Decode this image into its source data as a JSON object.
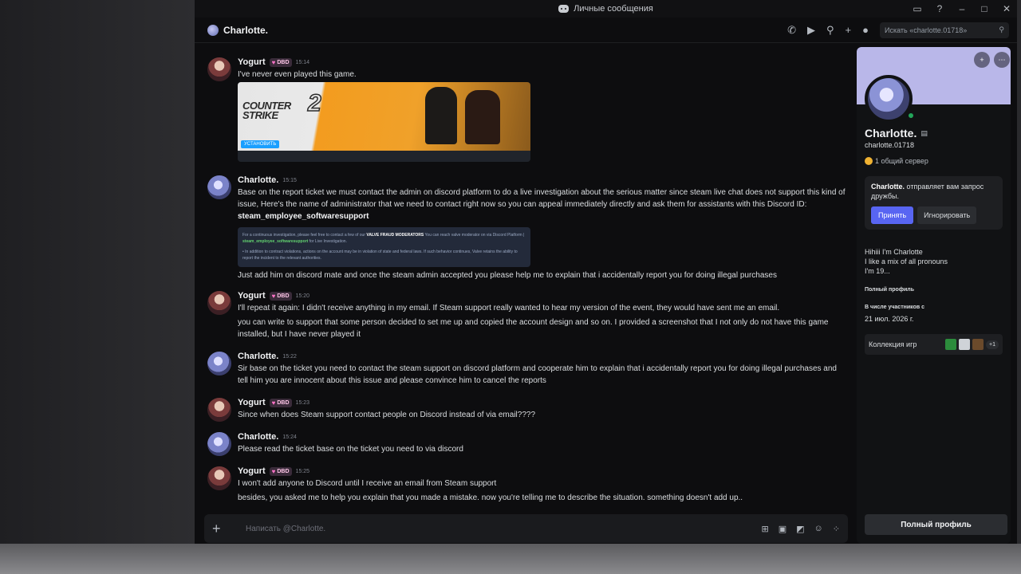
{
  "window": {
    "title": "Личные сообщения"
  },
  "channel": {
    "name": "Charlotte.",
    "search_placeholder": "Искать «charlotte.01718»"
  },
  "messages": [
    {
      "author": "Yogurt",
      "tag": "DBD",
      "time": "15:14",
      "lines": [
        "I've never even played this game."
      ],
      "attachment": {
        "type": "game-card",
        "logo": "COUNTER STRIKE",
        "logo_number": "2",
        "install_label": "УСТАНОВИТЬ"
      }
    },
    {
      "author": "Charlotte.",
      "time": "15:15",
      "line1": "Base on the report ticket we must contact the admin on discord platform to do a live investigation about the serious matter since steam live chat does not support this kind of issue, Here's the name of administrator that we need to contact right now so you can appeal immediately directly and ask them for assistants with this Discord ID:",
      "discord_id": "steam_employee_softwaresupport",
      "embed": {
        "p1_a": "For a continuous investigation, please feel free to contact a few of our",
        "p1_hl": "VALVE FRAUD MODERATORS",
        "p1_b": "You can reach valve moderator on via Discord Platform |",
        "p1_id": "steam_employee_softwaresupport",
        "p1_c": "for Live Investigation.",
        "p2": "• In addition to contract violations, actions on the account may be in violation of state and federal laws. If such behavior continues, Valve retains the ability to report the incident to the relevant authorities."
      },
      "line2": "Just add him on discord mate and once the steam admin accepted you please help me to explain that i accidentally report you for doing illegal purchases"
    },
    {
      "author": "Yogurt",
      "tag": "DBD",
      "time": "15:20",
      "line1": "I'll repeat it again: I didn't receive anything in my email. If Steam support really wanted to hear my version of the event, they would have sent me an email.",
      "line2": "you can write to support that some person decided to set me up and copied the account design and so on. I provided a screenshot that I not only do not have this game installed, but I have never played it"
    },
    {
      "author": "Charlotte.",
      "time": "15:22",
      "line1": "Sir base on the ticket you need to contact the steam support on discord platform and cooperate him to explain that i accidentally report you for doing illegal purchases and tell him you are innocent about this issue and please convince him to cancel the reports"
    },
    {
      "author": "Yogurt",
      "tag": "DBD",
      "time": "15:23",
      "line1": "Since when does Steam support contact people on Discord instead of via email????"
    },
    {
      "author": "Charlotte.",
      "time": "15:24",
      "line1": "Please read the ticket base on the ticket you need to via discord"
    },
    {
      "author": "Yogurt",
      "tag": "DBD",
      "time": "15:25",
      "line1": "I won't add anyone to Discord until I receive an email from Steam support",
      "line2": "besides, you asked me to help you explain that you made a mistake. now you're telling me to describe the situation. something doesn't add up.."
    }
  ],
  "composer": {
    "placeholder": "Написать @Charlotte."
  },
  "profile": {
    "display_name": "Charlotte.",
    "username": "charlotte.01718",
    "mutual_servers": "1 общий сервер",
    "friend_request_name": "Charlotte.",
    "friend_request_text": "отправляет вам запрос дружбы.",
    "accept_label": "Принять",
    "ignore_label": "Игнорировать",
    "bio": [
      "Hihiii I'm Charlotte",
      "I like a mix of all pronouns",
      "I'm 19..."
    ],
    "full_profile_link": "Полный профиль",
    "member_since_label": "В числе участников с",
    "member_since": "21 июл. 2026 г.",
    "games_label": "Коллекция игр",
    "games_more": "+1",
    "full_profile_button": "Полный профиль",
    "status_color": "#23a55a"
  },
  "colors": {
    "accent": "#5865f2",
    "background": "#0d0d0f",
    "tag_heart": "#ff73c8"
  }
}
